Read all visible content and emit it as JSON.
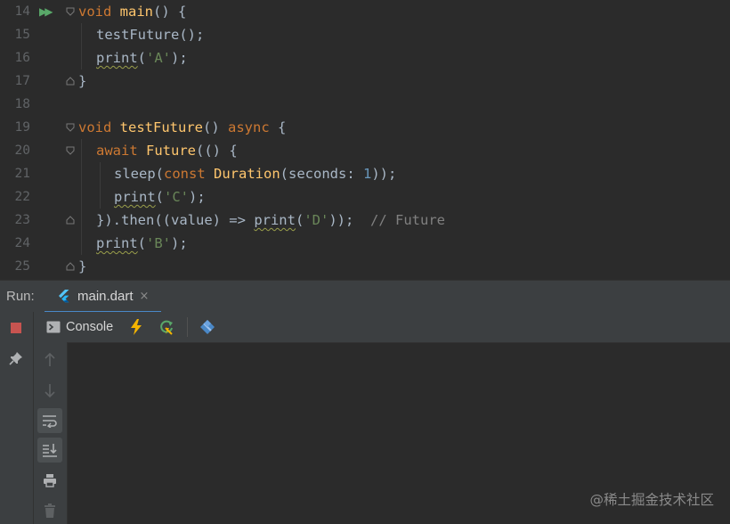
{
  "editor": {
    "lines": [
      {
        "num": "14"
      },
      {
        "num": "15"
      },
      {
        "num": "16"
      },
      {
        "num": "17"
      },
      {
        "num": "18"
      },
      {
        "num": "19"
      },
      {
        "num": "20"
      },
      {
        "num": "21"
      },
      {
        "num": "22"
      },
      {
        "num": "23"
      },
      {
        "num": "24"
      },
      {
        "num": "25"
      }
    ],
    "code": {
      "void1": "void",
      "main_fn": "main",
      "main_tail": "() {",
      "call_test": "testFuture",
      "call_tail": "();",
      "print": "print",
      "open_paren": "(",
      "str_a": "'A'",
      "close_semi": ");",
      "brace_close": "}",
      "void2": "void",
      "test_fn": "testFuture",
      "paren_pair": "() ",
      "async": "async",
      "open_brace": " {",
      "await": "await",
      "future": "Future",
      "future_tail": "(() {",
      "sleep": "sleep(",
      "const": "const",
      "duration": "Duration",
      "seconds": "(seconds: ",
      "one": "1",
      "sleep_tail": "));",
      "str_c": "'C'",
      "then_head": "}).then((value) => ",
      "str_d": "'D'",
      "then_close": "));",
      "comment": "// Future",
      "str_b": "'B'"
    }
  },
  "run": {
    "label": "Run:",
    "tab_label": "main.dart",
    "close_glyph": "×"
  },
  "toolbar": {
    "console_label": "Console"
  },
  "watermark": "@稀土掘金技术社区",
  "colors": {
    "keyword": "#cc7832",
    "function": "#ffc66d",
    "string": "#6a8759",
    "number": "#6897bb",
    "comment": "#808080",
    "text": "#a9b7c6",
    "stop": "#c75450",
    "accent": "#4a88c7"
  }
}
